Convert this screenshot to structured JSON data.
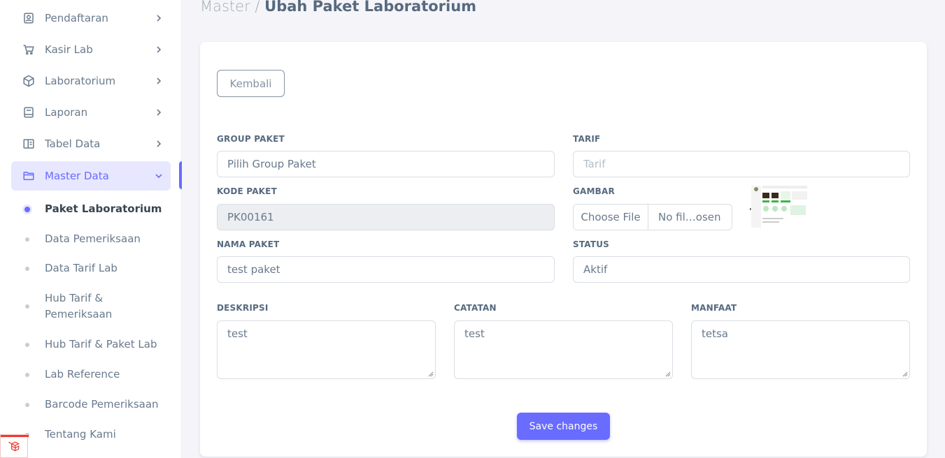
{
  "sidebar": {
    "menu": [
      {
        "label": "Pendaftaran",
        "icon": "registration-icon"
      },
      {
        "label": "Kasir Lab",
        "icon": "cart-icon"
      },
      {
        "label": "Laboratorium",
        "icon": "cube-icon"
      },
      {
        "label": "Laporan",
        "icon": "report-icon"
      },
      {
        "label": "Tabel Data",
        "icon": "table-icon"
      },
      {
        "label": "Master Data",
        "icon": "folder-icon"
      }
    ],
    "submenu": [
      {
        "label": "Paket Laboratorium",
        "active": true
      },
      {
        "label": "Data Pemeriksaan"
      },
      {
        "label": "Data Tarif Lab"
      },
      {
        "label": "Hub Tarif & Pemeriksaan"
      },
      {
        "label": "Hub Tarif & Paket Lab"
      },
      {
        "label": "Lab Reference"
      },
      {
        "label": "Barcode Pemeriksaan"
      },
      {
        "label": "Tentang Kami"
      }
    ]
  },
  "breadcrumb": {
    "parent": "Master /",
    "current": "Ubah Paket Laboratorium"
  },
  "form": {
    "back_label": "Kembali",
    "group_paket": {
      "label": "GROUP PAKET",
      "value": "Pilih Group Paket"
    },
    "tarif": {
      "label": "TARIF",
      "placeholder": "Tarif"
    },
    "kode_paket": {
      "label": "KODE PAKET",
      "value": "PK00161"
    },
    "gambar": {
      "label": "GAMBAR",
      "button": "Choose File",
      "filename": "No fil…osen"
    },
    "nama_paket": {
      "label": "NAMA PAKET",
      "value": "test paket"
    },
    "status": {
      "label": "STATUS",
      "value": "Aktif"
    },
    "deskripsi": {
      "label": "DESKRIPSI",
      "value": "test"
    },
    "catatan": {
      "label": "CATATAN",
      "value": "test"
    },
    "manfaat": {
      "label": "MANFAAT",
      "value": "tetsa"
    },
    "save_label": "Save changes"
  },
  "colors": {
    "primary": "#696cff",
    "primary_light": "#e7e7ff",
    "text": "#566a7f",
    "background": "#f5f5f9"
  }
}
